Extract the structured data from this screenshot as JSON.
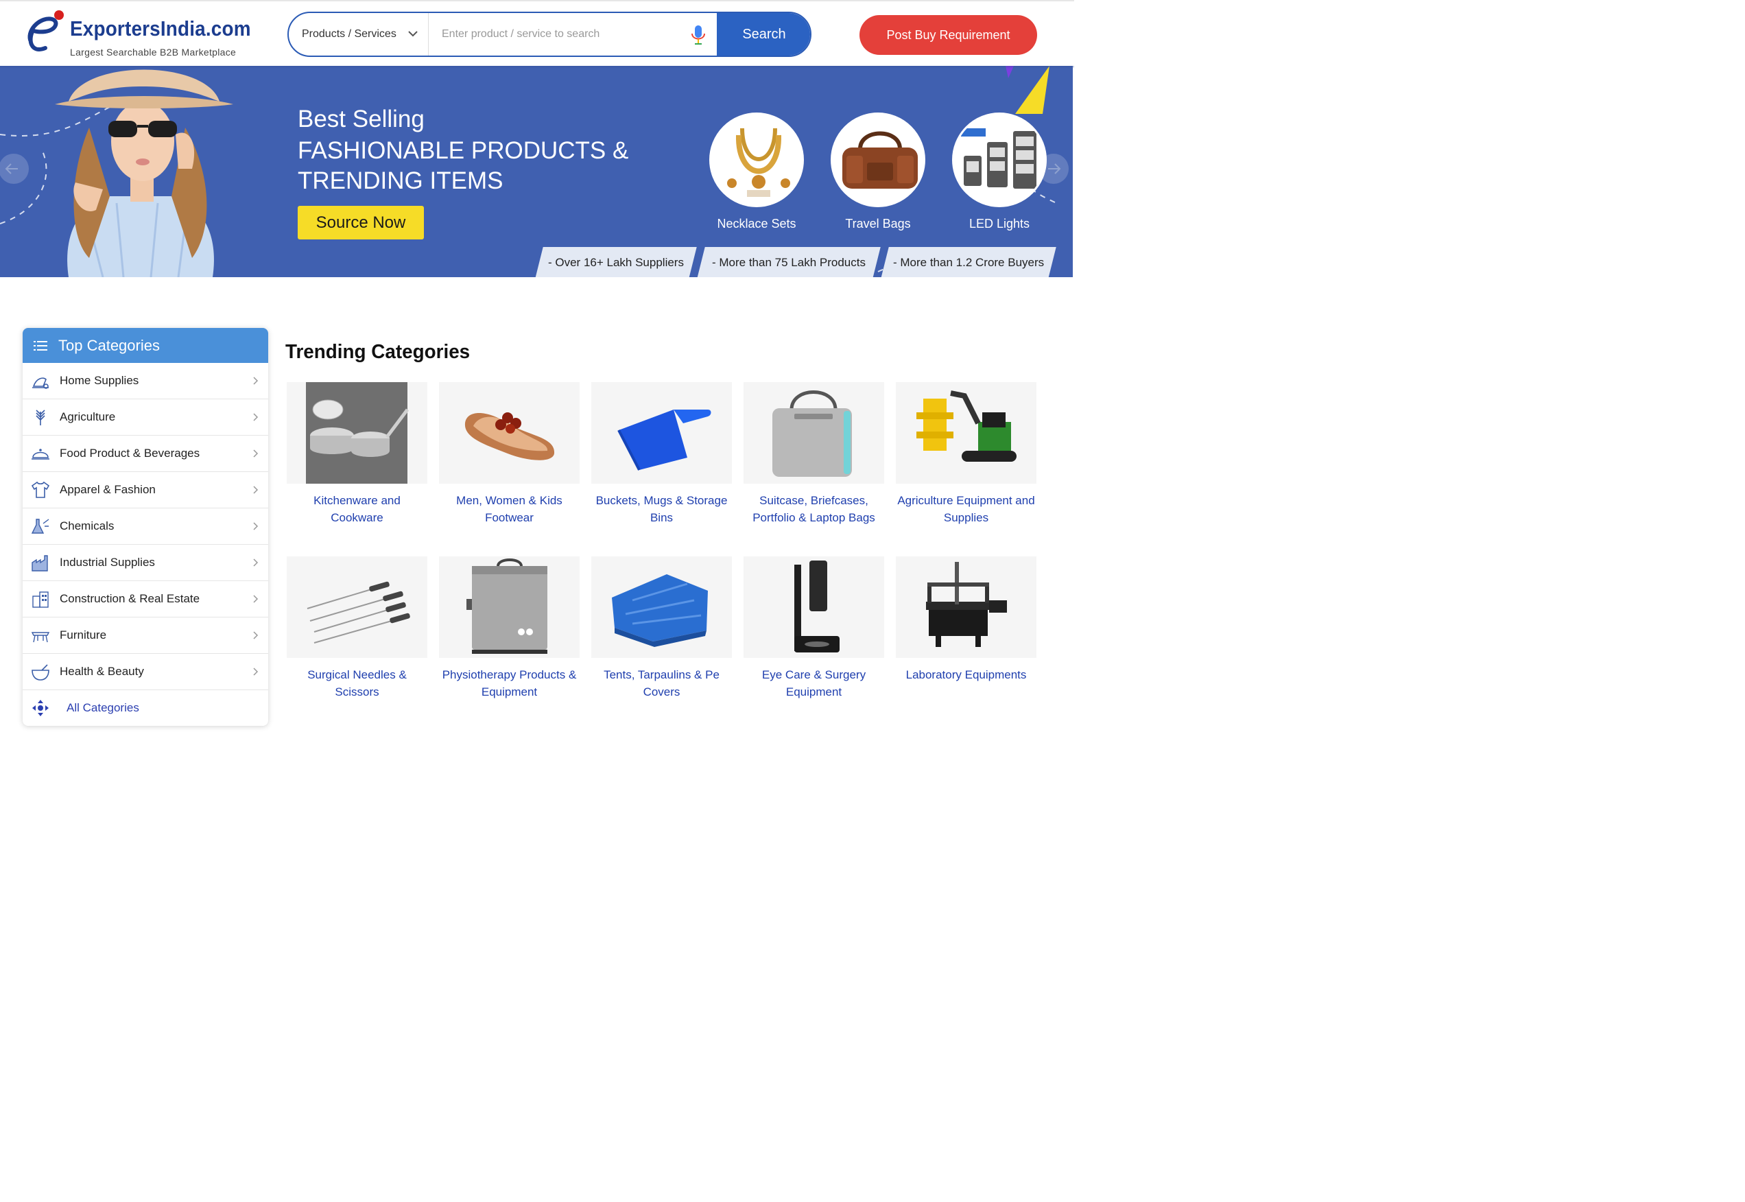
{
  "header": {
    "logo_name": "ExportersIndia.com",
    "logo_tagline": "Largest Searchable B2B Marketplace",
    "search_type": "Products / Services",
    "search_placeholder": "Enter product / service to search",
    "search_button": "Search",
    "post_button": "Post Buy Requirement"
  },
  "banner": {
    "subtitle": "Best Selling",
    "title": "FASHIONABLE PRODUCTS & TRENDING ITEMS",
    "cta": "Source Now",
    "products": [
      {
        "label": "Necklace Sets",
        "icon": "necklace-image"
      },
      {
        "label": "Travel Bags",
        "icon": "bag-image"
      },
      {
        "label": "LED Lights",
        "icon": "led-image"
      }
    ],
    "stats": [
      "- Over 16+ Lakh Suppliers",
      "- More than 75 Lakh Products",
      "- More than 1.2 Crore Buyers"
    ]
  },
  "sidebar": {
    "title": "Top Categories",
    "items": [
      {
        "label": "Home Supplies",
        "icon": "home-supplies-icon"
      },
      {
        "label": "Agriculture",
        "icon": "agriculture-icon"
      },
      {
        "label": "Food Product & Beverages",
        "icon": "food-icon"
      },
      {
        "label": "Apparel & Fashion",
        "icon": "apparel-icon"
      },
      {
        "label": "Chemicals",
        "icon": "chemicals-icon"
      },
      {
        "label": "Industrial Supplies",
        "icon": "industrial-icon"
      },
      {
        "label": "Construction & Real Estate",
        "icon": "construction-icon"
      },
      {
        "label": "Furniture",
        "icon": "furniture-icon"
      },
      {
        "label": "Health & Beauty",
        "icon": "health-icon"
      }
    ],
    "all_label": "All Categories"
  },
  "trending": {
    "title": "Trending Categories",
    "cards": [
      {
        "caption": "Kitchenware and Cookware",
        "icon": "cookware-image"
      },
      {
        "caption": "Men, Women & Kids Footwear",
        "icon": "sandal-image"
      },
      {
        "caption": "Buckets, Mugs & Storage Bins",
        "icon": "dustpan-image"
      },
      {
        "caption": "Suitcase, Briefcases, Portfolio & Laptop Bags",
        "icon": "laptop-bag-image"
      },
      {
        "caption": "Agriculture Equipment and Supplies",
        "icon": "forestry-machine-image"
      },
      {
        "caption": "Surgical Needles & Scissors",
        "icon": "needles-image"
      },
      {
        "caption": "Physiotherapy Products & Equipment",
        "icon": "physio-unit-image"
      },
      {
        "caption": "Tents, Tarpaulins & Pe Covers",
        "icon": "tarpaulin-image"
      },
      {
        "caption": "Eye Care & Surgery Equipment",
        "icon": "eye-device-image"
      },
      {
        "caption": "Laboratory Equipments",
        "icon": "cmm-machine-image"
      }
    ]
  },
  "colors": {
    "brand_blue": "#1c3d8f",
    "banner_blue": "#4060b0",
    "accent_red": "#e4403a",
    "cta_yellow": "#f6dc27",
    "link_blue": "#1f3fae",
    "sidebar_head": "#4a90d9"
  }
}
